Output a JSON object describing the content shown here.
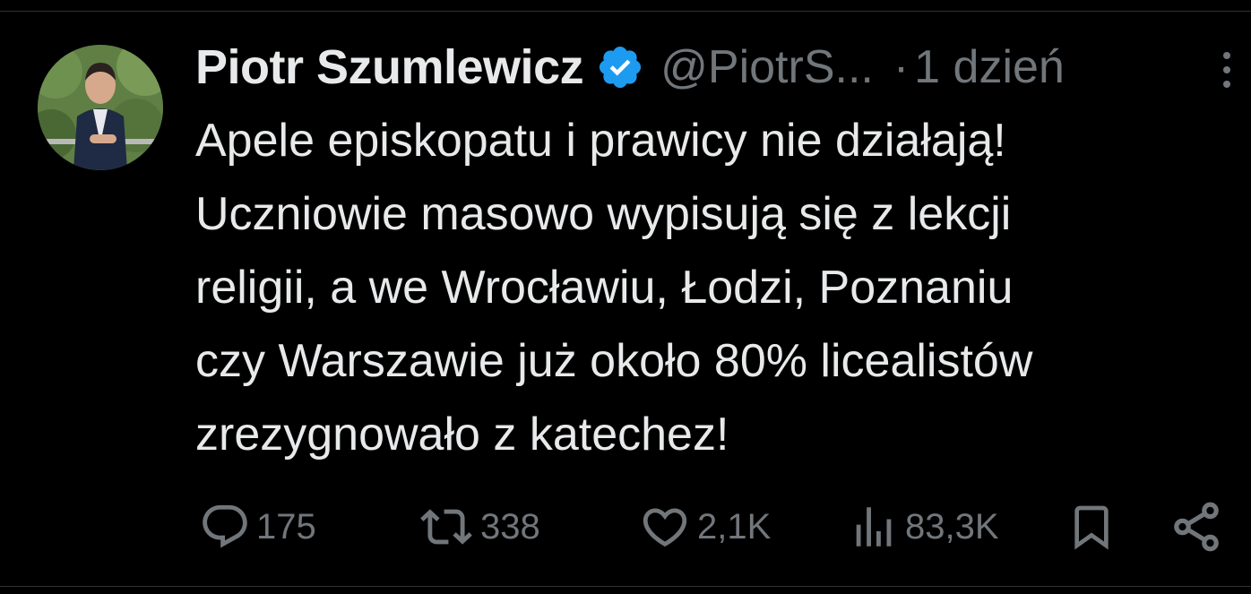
{
  "tweet": {
    "author_name": "Piotr Szumlewicz",
    "verified_icon": "verified-badge-icon",
    "handle": "@PiotrS...",
    "separator": "·",
    "time": "1 dzień",
    "text_lines": [
      "Apele episkopatu i prawicy nie działają!",
      "Uczniowie masowo wypisują się z lekcji",
      "religii, a we Wrocławiu, Łodzi, Poznaniu",
      "czy Warszawie już około 80% licealistów",
      "zrezygnowało z katechez!"
    ]
  },
  "actions": {
    "replies": "175",
    "retweets": "338",
    "likes": "2,1K",
    "views": "83,3K"
  },
  "colors": {
    "background": "#000000",
    "text": "#e7e9ea",
    "muted": "#71767b",
    "verified": "#1d9bf0",
    "divider": "#2f3336"
  }
}
